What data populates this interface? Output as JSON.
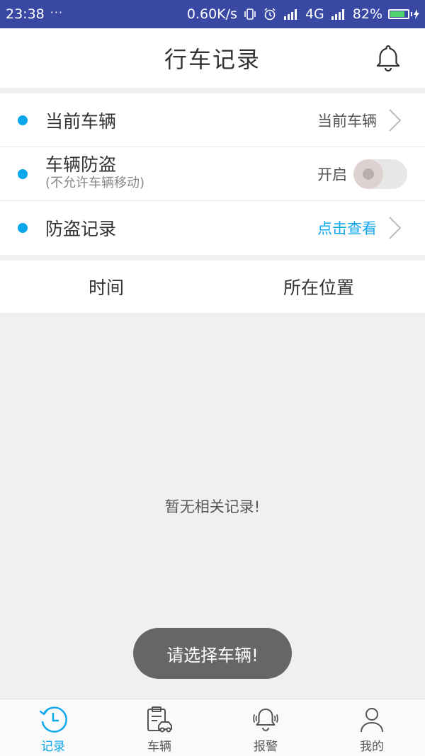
{
  "status_bar": {
    "time": "23:38",
    "dots": "···",
    "speed": "0.60K/s",
    "net1": "4G",
    "net2": "4G",
    "battery": "82%",
    "battery_level": 0.82
  },
  "header": {
    "title": "行车记录"
  },
  "rows": {
    "current_vehicle": {
      "label": "当前车辆",
      "value": "当前车辆"
    },
    "anti_theft": {
      "label": "车辆防盗",
      "sub": "(不允许车辆移动)",
      "toggle_label": "开启",
      "enabled": false
    },
    "theft_records": {
      "label": "防盗记录",
      "value": "点击查看"
    }
  },
  "columns": {
    "time": "时间",
    "location": "所在位置"
  },
  "empty_text": "暂无相关记录!",
  "toast": "请选择车辆!",
  "tabs": [
    {
      "label": "记录",
      "icon": "history-icon",
      "active": true
    },
    {
      "label": "车辆",
      "icon": "vehicle-icon",
      "active": false
    },
    {
      "label": "报警",
      "icon": "alarm-icon",
      "active": false
    },
    {
      "label": "我的",
      "icon": "user-icon",
      "active": false
    }
  ],
  "colors": {
    "accent": "#0aa6ee",
    "status_bar": "#3949a3",
    "toast_bg": "#666666"
  }
}
